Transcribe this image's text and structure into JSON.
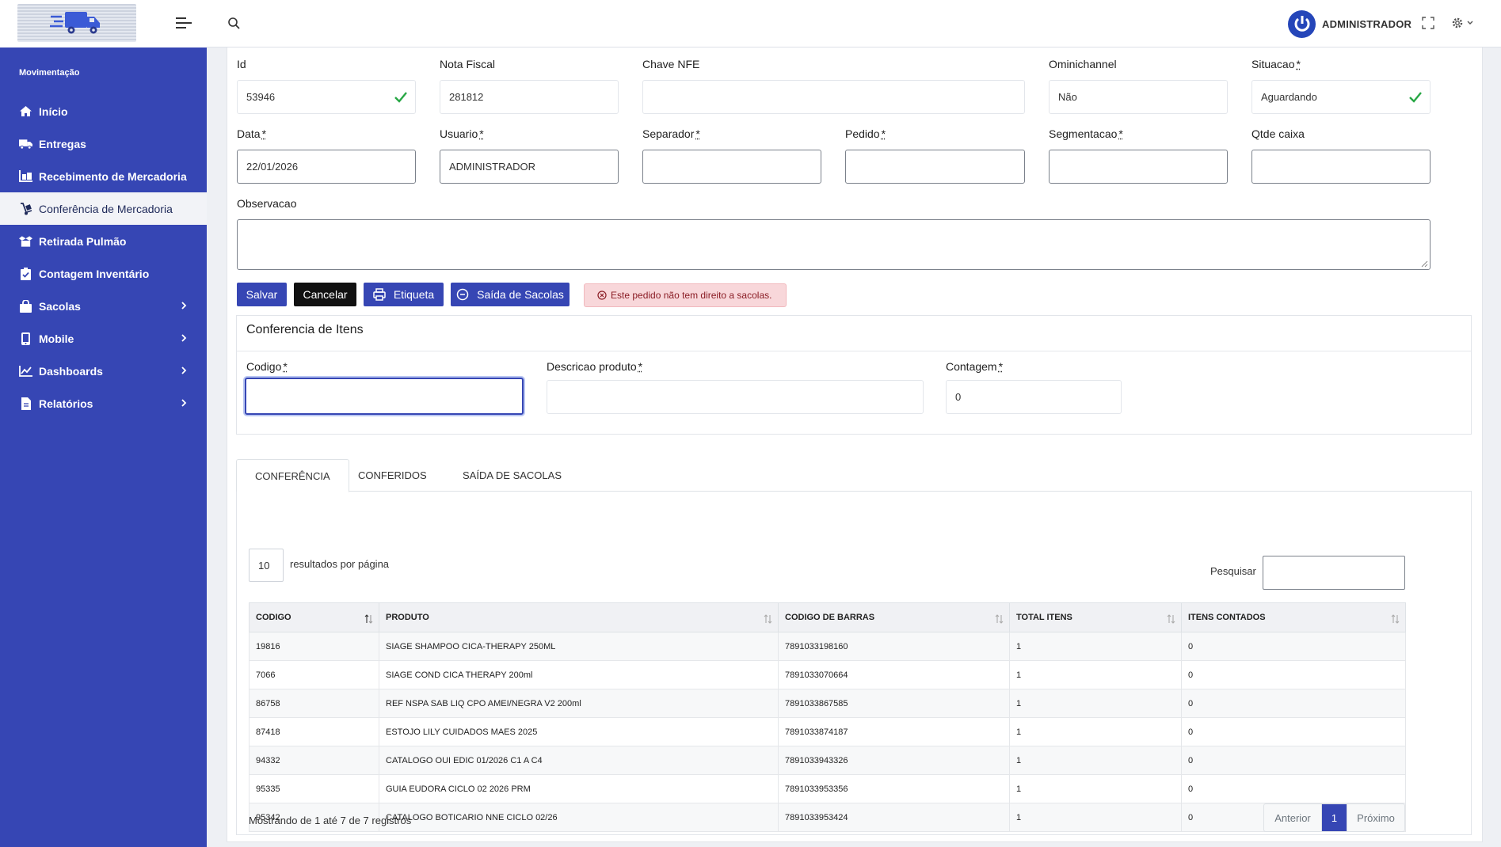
{
  "sidebar": {
    "section_label": "Movimentação",
    "items": [
      {
        "label": "Início",
        "icon": "home-icon",
        "has_children": false,
        "active": false
      },
      {
        "label": "Entregas",
        "icon": "truck-icon",
        "has_children": false,
        "active": false
      },
      {
        "label": "Recebimento de Mercadoria",
        "icon": "warehouse-icon",
        "has_children": false,
        "active": false
      },
      {
        "label": "Conferência de Mercadoria",
        "icon": "dolly-icon",
        "has_children": false,
        "active": true
      },
      {
        "label": "Retirada Pulmão",
        "icon": "box-open-icon",
        "has_children": false,
        "active": false
      },
      {
        "label": "Contagem Inventário",
        "icon": "clipboard-check-icon",
        "has_children": false,
        "active": false
      },
      {
        "label": "Sacolas",
        "icon": "shopping-bag-icon",
        "has_children": true,
        "active": false
      },
      {
        "label": "Mobile",
        "icon": "mobile-icon",
        "has_children": true,
        "active": false
      },
      {
        "label": "Dashboards",
        "icon": "chart-line-icon",
        "has_children": true,
        "active": false
      },
      {
        "label": "Relatórios",
        "icon": "file-icon",
        "has_children": true,
        "active": false
      }
    ]
  },
  "topbar": {
    "user_name": "ADMINISTRADOR"
  },
  "form": {
    "id": {
      "label": "Id",
      "value": "53946"
    },
    "nota_fiscal": {
      "label": "Nota Fiscal",
      "value": "281812"
    },
    "chave_nfe": {
      "label": "Chave NFE",
      "value": ""
    },
    "ominichannel": {
      "label": "Ominichannel",
      "value": "Não"
    },
    "situacao": {
      "label": "Situacao",
      "value": "Aguardando"
    },
    "data": {
      "label": "Data",
      "value": "22/01/2026"
    },
    "usuario": {
      "label": "Usuario",
      "value": "ADMINISTRADOR"
    },
    "separador": {
      "label": "Separador",
      "value": ""
    },
    "pedido": {
      "label": "Pedido",
      "value": ""
    },
    "segmentacao": {
      "label": "Segmentacao",
      "value": ""
    },
    "qtde_caixa": {
      "label": "Qtde caixa",
      "value": ""
    },
    "observacao": {
      "label": "Observacao",
      "value": ""
    },
    "required_mark": "*"
  },
  "actions": {
    "salvar": "Salvar",
    "cancelar": "Cancelar",
    "etiqueta": "Etiqueta",
    "saida_sacolas": "Saída de Sacolas",
    "alert": "Este pedido não tem direito a sacolas."
  },
  "conferencia": {
    "title": "Conferencia de Itens",
    "codigo": {
      "label": "Codigo",
      "value": ""
    },
    "descricao": {
      "label": "Descricao produto",
      "value": ""
    },
    "contagem": {
      "label": "Contagem",
      "value": "0"
    }
  },
  "tabs": [
    {
      "label": "CONFERÊNCIA",
      "active": true
    },
    {
      "label": "CONFERIDOS",
      "active": false
    },
    {
      "label": "SAÍDA DE SACOLAS",
      "active": false
    }
  ],
  "table": {
    "per_page": "10",
    "per_page_label": "resultados por página",
    "search_label": "Pesquisar",
    "columns": [
      "CODIGO",
      "PRODUTO",
      "CODIGO DE BARRAS",
      "TOTAL ITENS",
      "ITENS CONTADOS"
    ],
    "rows": [
      [
        "19816",
        "SIAGE SHAMPOO CICA-THERAPY 250ML",
        "7891033198160",
        "1",
        "0"
      ],
      [
        "7066",
        "SIAGE COND CICA THERAPY 200ml",
        "7891033070664",
        "1",
        "0"
      ],
      [
        "86758",
        "REF NSPA SAB LIQ CPO AMEI/NEGRA V2 200ml",
        "7891033867585",
        "1",
        "0"
      ],
      [
        "87418",
        "ESTOJO LILY CUIDADOS MAES 2025",
        "7891033874187",
        "1",
        "0"
      ],
      [
        "94332",
        "CATALOGO OUI EDIC 01/2026 C1 A C4",
        "7891033943326",
        "1",
        "0"
      ],
      [
        "95335",
        "GUIA EUDORA CICLO 02 2026 PRM",
        "7891033953356",
        "1",
        "0"
      ],
      [
        "95342",
        "CATALOGO BOTICARIO NNE CICLO 02/26",
        "7891033953424",
        "1",
        "0"
      ]
    ],
    "showing": "Mostrando de 1 até 7 de 7 registros",
    "pager": {
      "prev": "Anterior",
      "current": "1",
      "next": "Próximo"
    }
  },
  "colors": {
    "brand": "#3646b4",
    "success_check": "#28a745",
    "alert_bg": "#f8d7da",
    "alert_text": "#8a1c24"
  }
}
